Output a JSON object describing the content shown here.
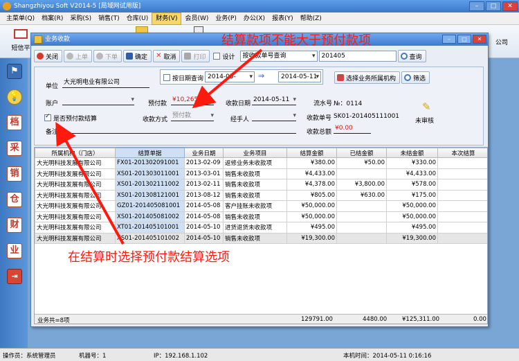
{
  "app": {
    "title": "Shangzhiyou Soft V2014-5 [局域网试用版]",
    "menu": [
      "主菜单(Q)",
      "档案(R)",
      "采购(S)",
      "销售(T)",
      "仓库(U)",
      "财务(V)",
      "会员(W)",
      "业务(P)",
      "办公(X)",
      "报表(Y)",
      "帮助(Z)"
    ],
    "active_menu_index": 5,
    "sms_label": "短信平",
    "company_tail": "公司"
  },
  "sidebar": {
    "items": [
      {
        "icon": "flag-icon",
        "glyph": "⚑"
      },
      {
        "icon": "lightbulb-icon",
        "glyph": "💡"
      },
      {
        "icon": "archive-icon",
        "glyph": "档"
      },
      {
        "icon": "purchase-icon",
        "glyph": "采"
      },
      {
        "icon": "sales-icon",
        "glyph": "销"
      },
      {
        "icon": "warehouse-icon",
        "glyph": "仓"
      },
      {
        "icon": "finance-icon",
        "glyph": "财"
      },
      {
        "icon": "business-icon",
        "glyph": "业"
      },
      {
        "icon": "exit-icon",
        "glyph": "⇥"
      }
    ]
  },
  "dialog": {
    "title": "业务收款",
    "toolbar": {
      "close": "关闭",
      "prev": "上单",
      "next": "下单",
      "confirm": "确定",
      "cancel": "取消",
      "print": "打印",
      "design": "设计",
      "query_mode": "按收款单号查询",
      "query_value": "201405",
      "query_btn": "查询"
    },
    "form": {
      "date_query_label": "按日期查询",
      "date_from": "2014-05-",
      "date_to": "2014-05-11",
      "select_org_btn": "选择业务所属机构",
      "filter_btn": "筛选",
      "unit_label": "单位",
      "unit_value": "大光明电业有限公司",
      "account_label": "账户",
      "prepaid_label": "预付款",
      "prepaid_value": "¥10,265.00",
      "pay_date_label": "收款日期",
      "pay_date_value": "2014-05-11",
      "serial_label": "流水号",
      "serial_value": "№：0114",
      "use_prepaid_label": "是否预付款结算",
      "pay_method_label": "收款方式",
      "pay_method_value": "预付款",
      "handler_label": "经手人",
      "receipt_no_label": "收款单号",
      "receipt_no_value": "SK01-201405111001",
      "note_label": "备注",
      "total_label": "收款总额",
      "total_value": "¥0.00",
      "audit_label": "未审核"
    },
    "grid": {
      "headers": [
        "所属机构（门店）",
        "结算单据",
        "业务日期",
        "业务项目",
        "结算金额",
        "已结金额",
        "未结金额",
        "本次结算"
      ],
      "rows": [
        [
          "大光明科技发展有限公司",
          "FX01-201302091001",
          "2013-02-09",
          "返修业务未收款项",
          "¥380.00",
          "¥50.00",
          "¥330.00",
          ""
        ],
        [
          "大光明科技发展有限公司",
          "XS01-201303011001",
          "2013-03-01",
          "销售未收款项",
          "¥4,433.00",
          "",
          "¥4,433.00",
          ""
        ],
        [
          "大光明科技发展有限公司",
          "XS01-201302111002",
          "2013-02-11",
          "销售未收款项",
          "¥4,378.00",
          "¥3,800.00",
          "¥578.00",
          ""
        ],
        [
          "大光明科技发展有限公司",
          "XS01-201308121001",
          "2013-08-12",
          "销售未收款项",
          "¥805.00",
          "¥630.00",
          "¥175.00",
          ""
        ],
        [
          "大光明科技发展有限公司",
          "GZ01-201405081001",
          "2014-05-08",
          "客户挂账未收款项",
          "¥50,000.00",
          "",
          "¥50,000.00",
          ""
        ],
        [
          "大光明科技发展有限公司",
          "XS01-201405081002",
          "2014-05-08",
          "销售未收款项",
          "¥50,000.00",
          "",
          "¥50,000.00",
          ""
        ],
        [
          "大光明科技发展有限公司",
          "XT01-201405101001",
          "2014-05-10",
          "进货退货未收款项",
          "¥495.00",
          "",
          "¥495.00",
          ""
        ],
        [
          "大光明科技发展有限公司",
          "XS01-201405101002",
          "2014-05-10",
          "销售未收款项",
          "¥19,300.00",
          "",
          "¥19,300.00",
          ""
        ]
      ],
      "totals": {
        "count": "业务共=8项",
        "sum_amount": "129791.00",
        "sum_paid": "4480.00",
        "sum_unpaid": "¥125,311.00",
        "sum_current": "0.00"
      }
    }
  },
  "status": {
    "operator": "操作员：系统管理员",
    "machine": "机器号：1",
    "ip": "IP：192.168.1.102",
    "time": "本机时间：2014-05-11 0:16:16"
  },
  "annotations": {
    "top": "结算款项不能大于预付款项",
    "bottom": "在结算时选择预付款结算选项"
  },
  "colors": {
    "annotation": "#ff1a10",
    "prepaid_text": "#d8140c",
    "active_menu": "#f7d76a"
  }
}
